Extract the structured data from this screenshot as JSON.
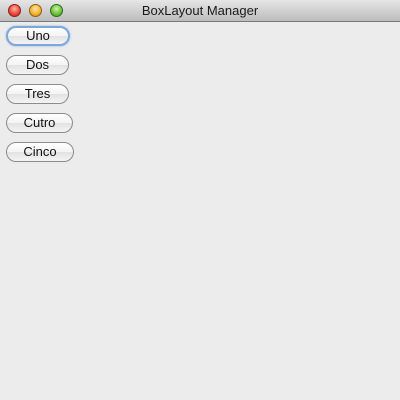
{
  "window": {
    "title": "BoxLayout Manager"
  },
  "buttons": [
    {
      "label": "Uno",
      "focused": true
    },
    {
      "label": "Dos",
      "focused": false
    },
    {
      "label": "Tres",
      "focused": false
    },
    {
      "label": "Cutro",
      "focused": false
    },
    {
      "label": "Cinco",
      "focused": false
    }
  ]
}
